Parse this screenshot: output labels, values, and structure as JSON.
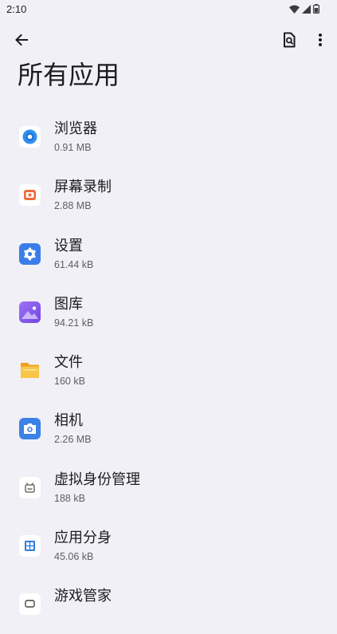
{
  "status_bar": {
    "time": "2:10",
    "icons": [
      "wifi-icon",
      "signal-icon",
      "battery-icon"
    ]
  },
  "toolbar": {
    "back_icon": "arrow-left-icon",
    "search_icon": "search-document-icon",
    "more_icon": "more-vertical-icon"
  },
  "page": {
    "title": "所有应用"
  },
  "apps": [
    {
      "name": "浏览器",
      "size": "0.91 MB",
      "icon": "browser-icon",
      "color": "#2f8ff0"
    },
    {
      "name": "屏幕录制",
      "size": "2.88 MB",
      "icon": "screen-recorder-icon",
      "color": "#f06a3a"
    },
    {
      "name": "设置",
      "size": "61.44 kB",
      "icon": "settings-icon",
      "color": "#3b7de8"
    },
    {
      "name": "图库",
      "size": "94.21 kB",
      "icon": "gallery-icon",
      "color": "#8c5cf0"
    },
    {
      "name": "文件",
      "size": "160 kB",
      "icon": "files-icon",
      "color": "#f7b733"
    },
    {
      "name": "相机",
      "size": "2.26 MB",
      "icon": "camera-icon",
      "color": "#3b82e8"
    },
    {
      "name": "虚拟身份管理",
      "size": "188 kB",
      "icon": "virtual-identity-icon",
      "color": "#555555"
    },
    {
      "name": "应用分身",
      "size": "45.06 kB",
      "icon": "app-clone-icon",
      "color": "#2f7fe0"
    },
    {
      "name": "游戏管家",
      "size": "",
      "icon": "game-manager-icon",
      "color": "#444444"
    }
  ]
}
